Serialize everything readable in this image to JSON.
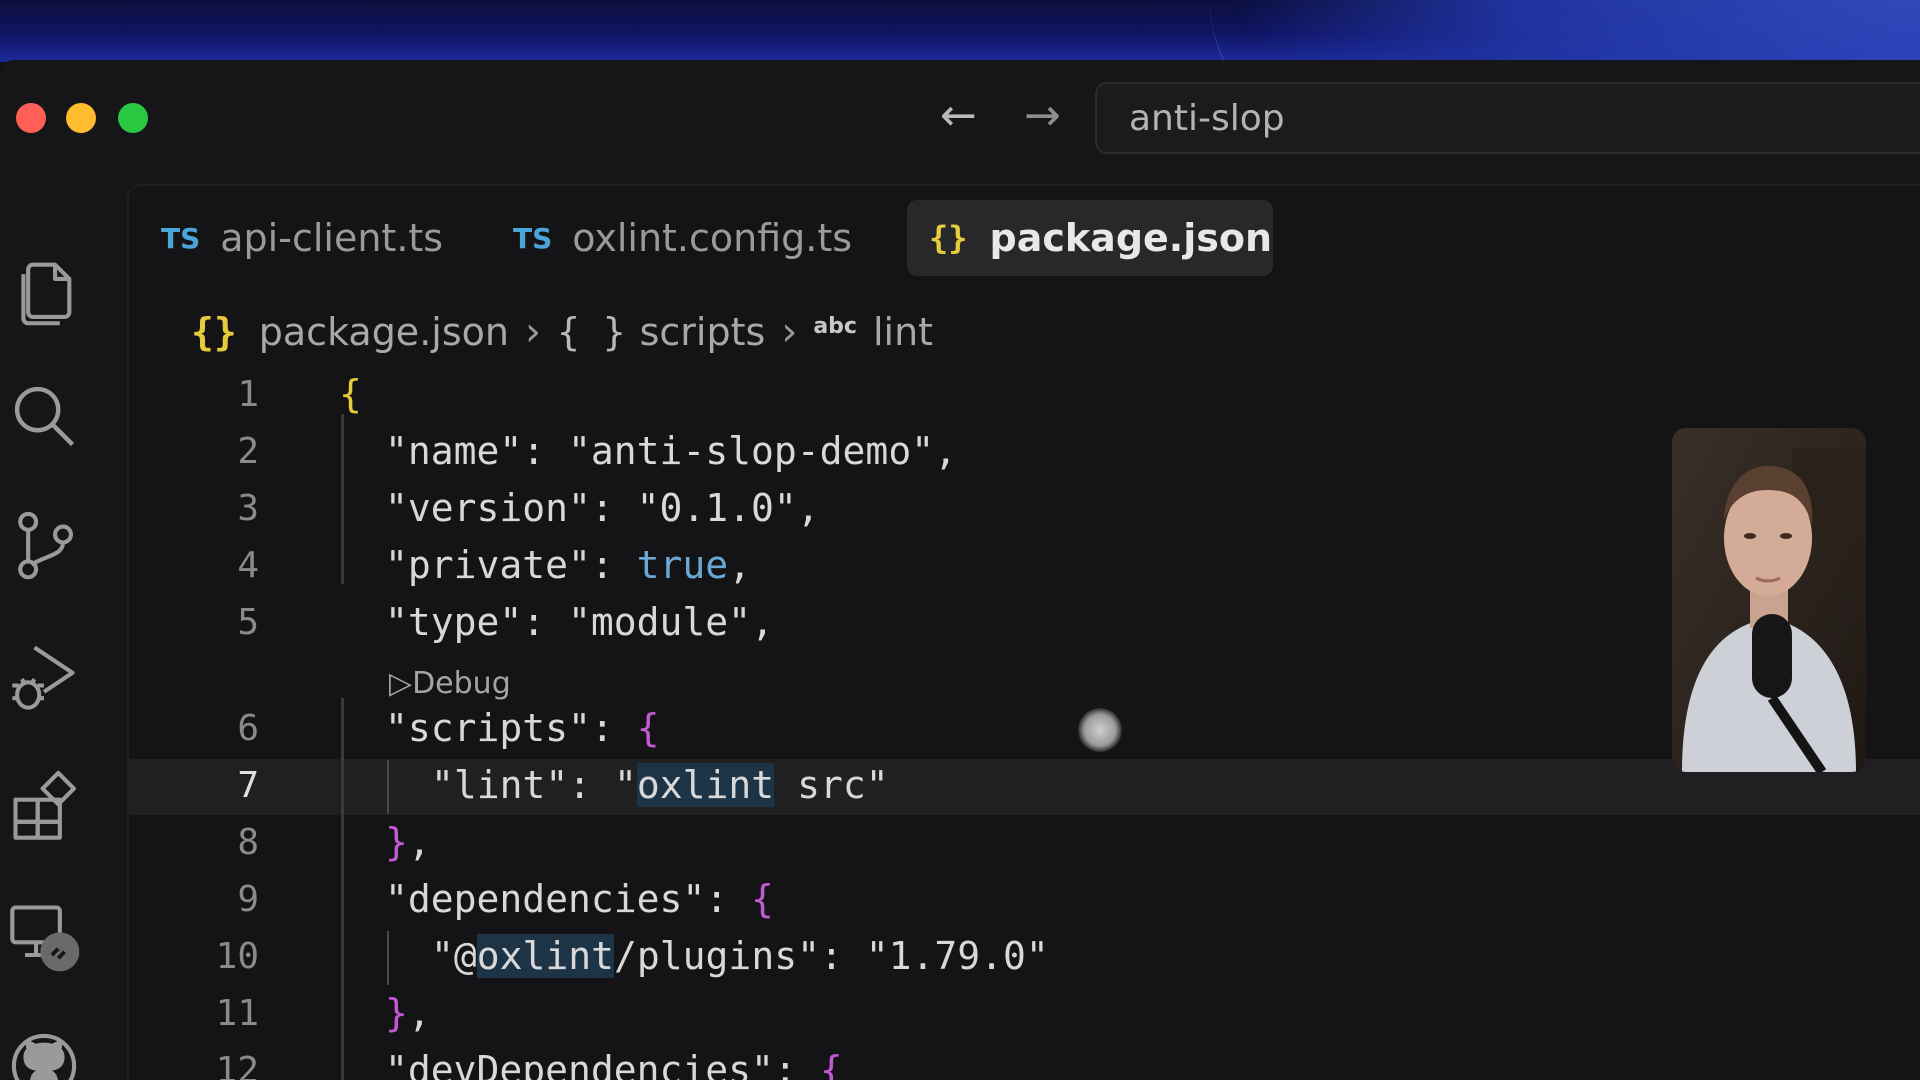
{
  "window": {
    "search_text": "anti-slop"
  },
  "tabs": [
    {
      "icon": "TS",
      "label": "api-client.ts",
      "active": false
    },
    {
      "icon": "TS",
      "label": "oxlint.config.ts",
      "active": false
    },
    {
      "icon": "{}",
      "label": "package.json",
      "active": true
    }
  ],
  "breadcrumb": {
    "file_icon": "{}",
    "file": "package.json",
    "scope_icon": "{ }",
    "scope": "scripts",
    "leaf_icon": "abc",
    "leaf": "lint"
  },
  "codelens": "Debug",
  "lines": [
    {
      "n": "1",
      "text": "{"
    },
    {
      "n": "2",
      "text": "\"name\": \"anti-slop-demo\","
    },
    {
      "n": "3",
      "text": "\"version\": \"0.1.0\","
    },
    {
      "n": "4",
      "text": "\"private\": true,"
    },
    {
      "n": "5",
      "text": "\"type\": \"module\","
    },
    {
      "n": "6",
      "text": "\"scripts\": {"
    },
    {
      "n": "7",
      "text": "\"lint\": \"oxlint src\""
    },
    {
      "n": "8",
      "text": "},"
    },
    {
      "n": "9",
      "text": "\"dependencies\": {"
    },
    {
      "n": "10",
      "text": "\"@oxlint/plugins\": \"1.79.0\""
    },
    {
      "n": "11",
      "text": "},"
    },
    {
      "n": "12",
      "text": "\"devDependencies\": {"
    }
  ],
  "activity_bar": [
    "explorer-icon",
    "search-icon",
    "source-control-icon",
    "run-debug-icon",
    "extensions-icon",
    "remote-explorer-icon",
    "github-icon"
  ],
  "colors": {
    "json_brace": "#e6cb3a",
    "bracket_pink": "#c25ad4",
    "boolean": "#6aa9d6",
    "ts_badge": "#4aa6d8"
  }
}
